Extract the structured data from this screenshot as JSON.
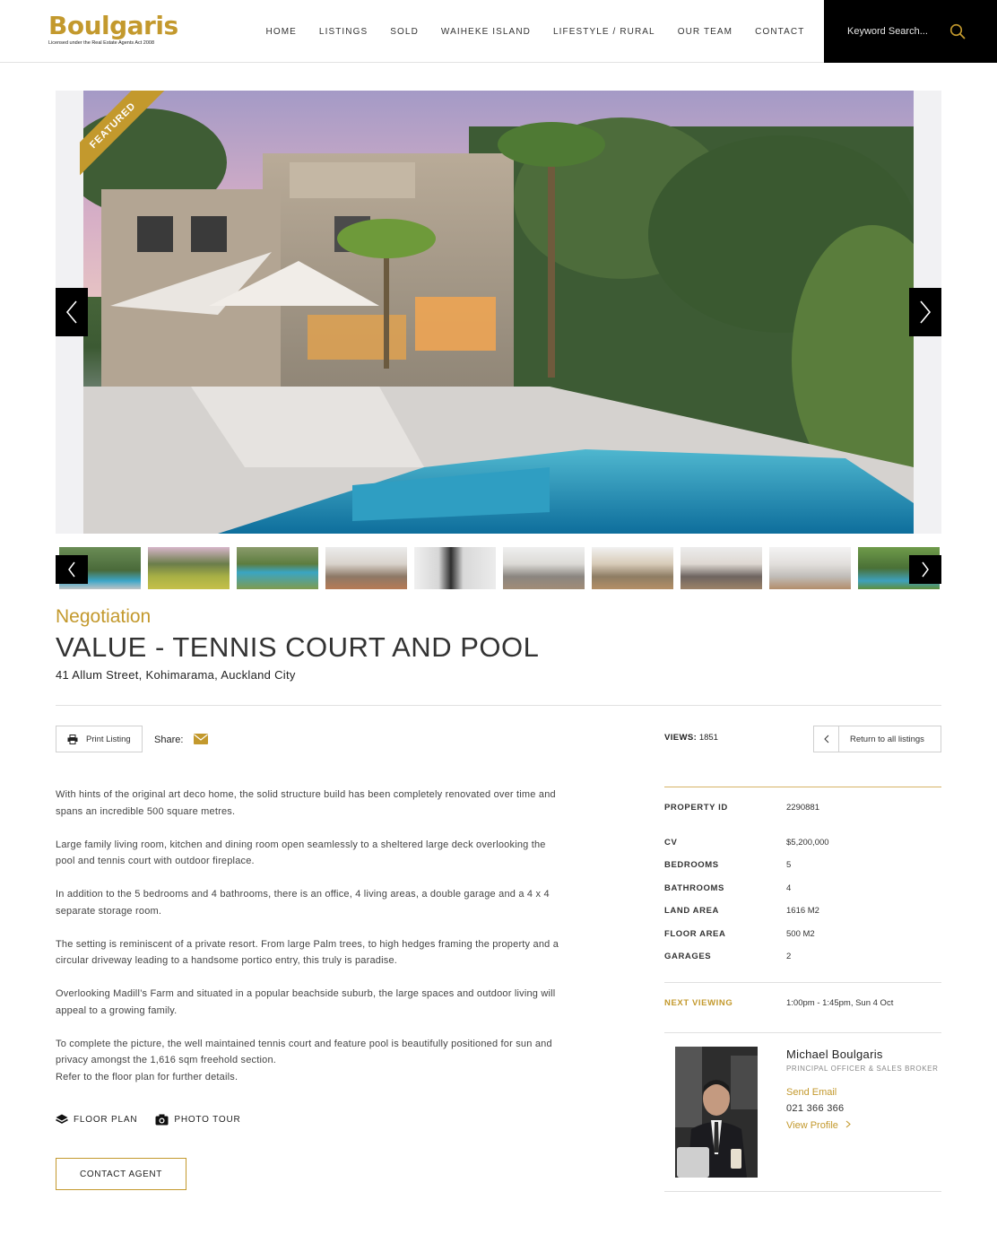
{
  "brand": {
    "name": "Boulgaris",
    "tagline": "Licensed under the Real Estate Agents Act 2008",
    "accent_color": "#c3992d"
  },
  "nav": {
    "items": [
      {
        "label": "HOME"
      },
      {
        "label": "LISTINGS"
      },
      {
        "label": "SOLD"
      },
      {
        "label": "WAIHEKE ISLAND"
      },
      {
        "label": "LIFESTYLE / RURAL"
      },
      {
        "label": "OUR TEAM"
      },
      {
        "label": "CONTACT"
      }
    ],
    "search_placeholder": "Keyword Search...",
    "search_icon": "search-icon"
  },
  "gallery": {
    "badge": "FEATURED",
    "thumbnail_count": 10
  },
  "listing": {
    "status": "Negotiation",
    "title": "VALUE - TENNIS COURT AND POOL",
    "address": "41 Allum Street, Kohimarama, Auckland City"
  },
  "toolbar": {
    "print_label": "Print Listing",
    "share_label": "Share:",
    "views_label": "VIEWS:",
    "views_value": "1851",
    "return_label": "Return to all listings"
  },
  "description": [
    "With hints of the original art deco home, the solid structure build has been completely renovated over time and spans an incredible 500 square metres.",
    "Large family living room, kitchen and dining room open seamlessly to a sheltered large deck overlooking the pool and tennis court with outdoor fireplace.",
    "In addition to the 5 bedrooms and 4 bathrooms, there is an office, 4 living areas, a double garage and a 4 x 4 separate storage room.",
    "The setting is reminiscent of a private resort. From large Palm trees, to high hedges framing the property and a circular driveway leading to a handsome portico entry, this truly is paradise.",
    "Overlooking Madill’s Farm and situated in a popular beachside suburb, the large spaces and outdoor living will appeal to a growing family.",
    "To complete the picture, the well maintained tennis court and feature pool is beautifully positioned for sun and privacy amongst the 1,616 sqm freehold section.",
    "Refer to the floor plan for further details."
  ],
  "media_links": {
    "floor_plan": "FLOOR PLAN",
    "photo_tour": "PHOTO TOUR"
  },
  "contact_button": "CONTACT AGENT",
  "details": {
    "property_id": {
      "label": "PROPERTY ID",
      "value": "2290881"
    },
    "rows": [
      {
        "label": "CV",
        "value": "$5,200,000"
      },
      {
        "label": "BEDROOMS",
        "value": "5"
      },
      {
        "label": "BATHROOMS",
        "value": "4"
      },
      {
        "label": "LAND AREA",
        "value": "1616 M2"
      },
      {
        "label": "FLOOR AREA",
        "value": "500 M2"
      },
      {
        "label": "GARAGES",
        "value": "2"
      }
    ],
    "next_viewing": {
      "label": "NEXT VIEWING",
      "value": "1:00pm - 1:45pm, Sun 4 Oct"
    }
  },
  "agent": {
    "name": "Michael Boulgaris",
    "role": "PRINCIPAL OFFICER & SALES BROKER",
    "email_label": "Send Email",
    "phone": "021 366 366",
    "profile_label": "View Profile"
  }
}
